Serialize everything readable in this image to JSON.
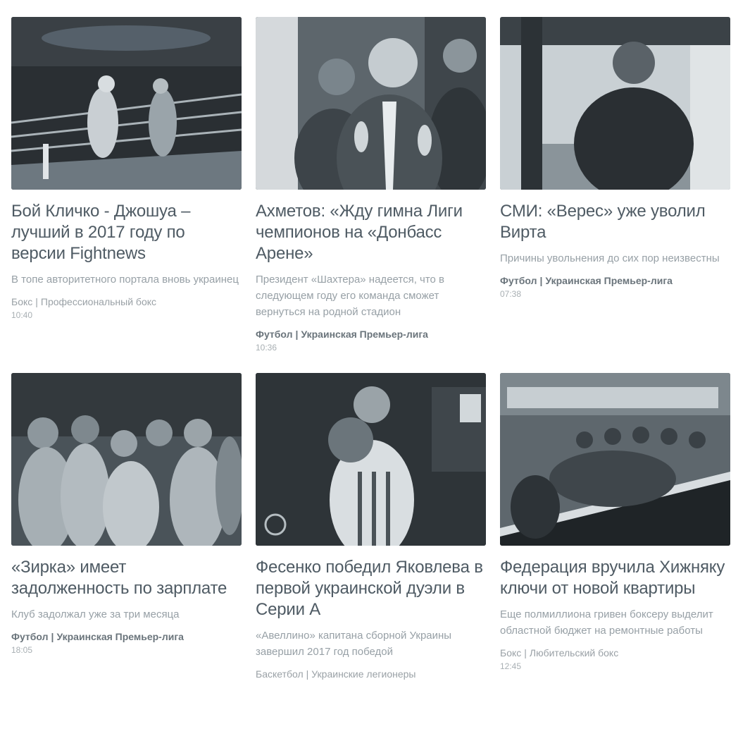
{
  "cards": [
    {
      "title": "Бой Кличко - Джошуа – лучший в 2017 году по версии Fightnews",
      "lead": "В топе авторитетного портала вновь украинец",
      "sport": "Бокс",
      "league": "Профессиональный бокс",
      "time": "10:40",
      "image": "boxing-ring-photo"
    },
    {
      "title": "Ахметов: «Жду гимна Лиги чемпионов на «Донбасс Арене»",
      "lead": "Президент «Шахтера» надеется, что в следующем году его команда сможет вернуться на родной стадион",
      "sport": "Футбол",
      "league": "Украинская Премьер-лига",
      "time": "10:36",
      "image": "president-crowd-photo"
    },
    {
      "title": "СМИ: «Верес» уже уволил Вирта",
      "lead": "Причины увольнения до сих пор неизвестны",
      "sport": "Футбол",
      "league": "Украинская Премьер-лига",
      "time": "07:38",
      "image": "coach-bench-photo"
    },
    {
      "title": "«Зирка» имеет задолженность по зарплате",
      "lead": "Клуб задолжал уже за три месяца",
      "sport": "Футбол",
      "league": "Украинская Премьер-лига",
      "time": "18:05",
      "image": "football-team-photo"
    },
    {
      "title": "Фесенко победил Яковлева в первой украинской дуэли в Серии А",
      "lead": "«Авеллино» капитана сборной Украины завершил 2017 год победой",
      "sport": "Баскетбол",
      "league": "Украинские легионеры",
      "time": "",
      "image": "basketball-player-photo"
    },
    {
      "title": "Федерация вручила Хижняку ключи от новой квартиры",
      "lead": "Еще полмиллиона гривен боксеру выделит областной бюджет на ремонтные работы",
      "sport": "Бокс",
      "league": "Любительский бокс",
      "time": "12:45",
      "image": "ceremony-hall-photo"
    }
  ],
  "colors": {
    "title": "#4f5b64",
    "lead": "#97a0a6",
    "category": "#9aa1a6",
    "background": "#ffffff"
  }
}
